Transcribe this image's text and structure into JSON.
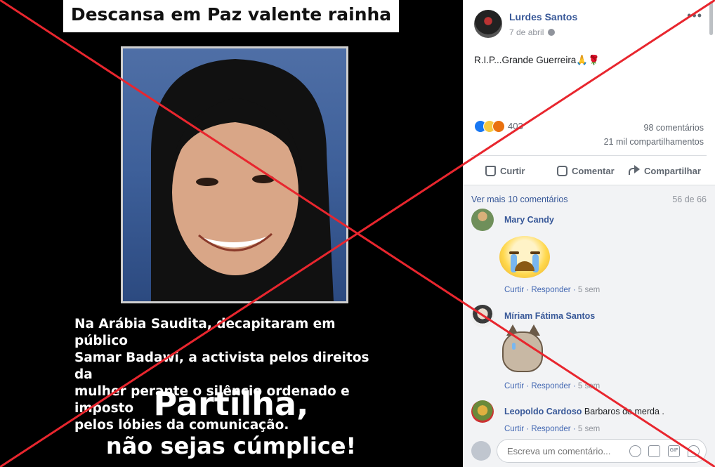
{
  "poster": {
    "title": "Descansa em Paz valente rainha",
    "caption_lines": [
      "Na Arábia Saudita, decapitaram em público",
      "Samar Badawi, a activista pelos direitos da",
      "mulher perante o silêncio ordenado e imposto",
      "pelos lóbies da comunicação."
    ],
    "cta_line1": "Partilha,",
    "cta_line2": "não sejas cúmplice!"
  },
  "post": {
    "author": "Lurdes Santos",
    "date": "7 de abril",
    "more_label": "•••",
    "text": "R.I.P...Grande Guerreira🙏🌹",
    "reactions_count": "403",
    "comments_count": "98 comentários",
    "shares_count": "21 mil compartilhamentos",
    "actions": {
      "like": "Curtir",
      "comment": "Comentar",
      "share": "Compartilhar"
    }
  },
  "comments_section": {
    "view_more": "Ver mais 10 comentários",
    "pager": "56 de 66",
    "comments": [
      {
        "name": "Mary Candy",
        "text": "",
        "like": "Curtir",
        "reply": "Responder",
        "time": "5 sem"
      },
      {
        "name": "Míriam Fátima Santos",
        "text": "",
        "like": "Curtir",
        "reply": "Responder",
        "time": "5 sem"
      },
      {
        "name": "Leopoldo Cardoso",
        "text": "Barbaros de merda .",
        "like": "Curtir",
        "reply": "Responder",
        "time": "5 sem"
      }
    ],
    "input_placeholder": "Escreva um comentário...",
    "gif_label": "GIF"
  },
  "colors": {
    "fb_link": "#385898",
    "overlay_x": "#e8262e"
  }
}
